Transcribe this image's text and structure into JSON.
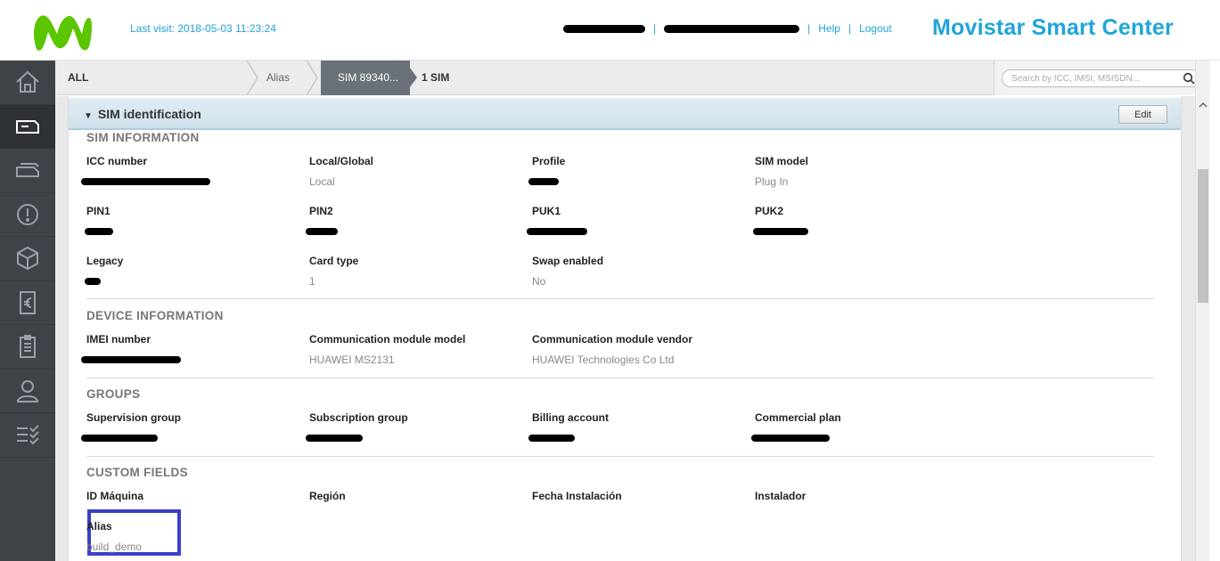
{
  "header": {
    "last_visit": "Last visit: 2018-05-03 11:23:24",
    "help": "Help",
    "logout": "Logout",
    "brand": "Movistar Smart Center",
    "accent": "#1fa5d8",
    "logo_color": "#5bc500"
  },
  "sidebar": {
    "items": [
      "home-icon",
      "sim-card-icon",
      "tag-icon",
      "alert-icon",
      "cube-icon",
      "billing-euro-icon",
      "clipboard-icon",
      "user-icon",
      "checklist-icon"
    ],
    "active": "sim-card-icon"
  },
  "breadcrumb": {
    "all": "ALL",
    "alias": "Alias",
    "sim": "SIM 89340...",
    "count": "1 SIM"
  },
  "search": {
    "placeholder": "Search by ICC, IMSI, MSISDN..."
  },
  "panel": {
    "title": "SIM identification",
    "edit": "Edit"
  },
  "sim_information": {
    "title": "SIM INFORMATION",
    "icc_label": "ICC number",
    "local_global_label": "Local/Global",
    "local_global_value": "Local",
    "profile_label": "Profile",
    "sim_model_label": "SIM model",
    "sim_model_value": "Plug In",
    "pin1_label": "PIN1",
    "pin2_label": "PIN2",
    "puk1_label": "PUK1",
    "puk2_label": "PUK2",
    "legacy_label": "Legacy",
    "card_type_label": "Card type",
    "card_type_value": "1",
    "swap_label": "Swap enabled",
    "swap_value": "No"
  },
  "device_information": {
    "title": "DEVICE INFORMATION",
    "imei_label": "IMEI number",
    "module_model_label": "Communication module model",
    "module_model_value": "HUAWEI MS2131",
    "module_vendor_label": "Communication module vendor",
    "module_vendor_value": "HUAWEI Technologies Co Ltd"
  },
  "groups": {
    "title": "GROUPS",
    "supervision_label": "Supervision group",
    "subscription_label": "Subscription group",
    "billing_label": "Billing account",
    "commercial_label": "Commercial plan"
  },
  "custom_fields": {
    "title": "CUSTOM FIELDS",
    "id_maquina_label": "ID Máquina",
    "region_label": "Región",
    "fecha_label": "Fecha Instalación",
    "instalador_label": "Instalador",
    "alias_label": "Alias",
    "alias_value": "build_demo"
  }
}
